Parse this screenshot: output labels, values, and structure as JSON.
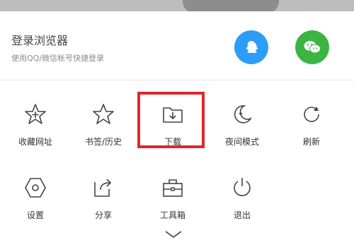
{
  "header": {
    "title": "登录浏览器",
    "subtitle": "使用QQ/微信帐号快捷登录",
    "login_buttons": [
      "qq-icon",
      "wechat-icon"
    ]
  },
  "menu": {
    "items": [
      {
        "label": "收藏网址",
        "icon": "star-plus-icon"
      },
      {
        "label": "书签/历史",
        "icon": "star-icon"
      },
      {
        "label": "下载",
        "icon": "download-folder-icon",
        "highlighted": true
      },
      {
        "label": "夜间模式",
        "icon": "moon-icon"
      },
      {
        "label": "刷新",
        "icon": "refresh-icon"
      },
      {
        "label": "设置",
        "icon": "settings-hexagon-icon"
      },
      {
        "label": "分享",
        "icon": "share-icon"
      },
      {
        "label": "工具箱",
        "icon": "toolbox-icon"
      },
      {
        "label": "退出",
        "icon": "power-icon"
      }
    ]
  },
  "colors": {
    "qq": "#2d9df7",
    "wechat": "#3bb542",
    "highlight_border": "#e0262d"
  },
  "footer": {
    "collapse_icon": "chevron-down-icon"
  }
}
